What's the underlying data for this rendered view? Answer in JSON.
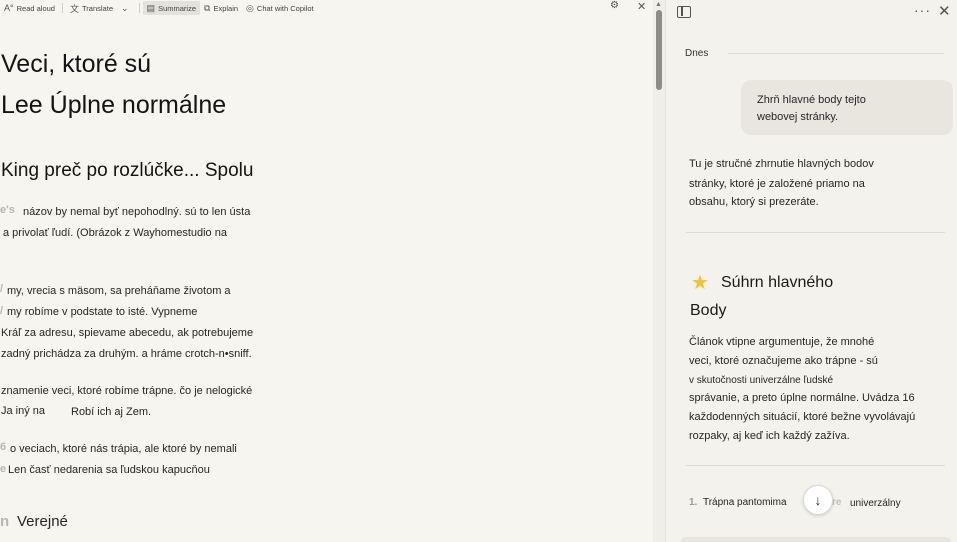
{
  "toolbar": {
    "read_aloud": "Read aloud",
    "translate": "Translate",
    "summarize": "Summarize",
    "explain": "Explain",
    "chat": "Chat with Copilot"
  },
  "article": {
    "title_line1": "Veci, ktoré sú",
    "title_line2": "Lee Úplne normálne",
    "subheading": "King preč po rozlúčke... Spolu",
    "ghost1": "e's",
    "p1_line1": "názov by nemal byť nepohodlný. sú to len ústa",
    "p1_line2": "a privolať ľudí. (Obrázok z Wayhomestudio na",
    "ghost2": "/",
    "p2_line1": "my, vrecia s mäsom, sa preháňame životom a",
    "ghost3": "/",
    "p2_line2": "my robíme v podstate to isté. Vypneme",
    "p2_line3": "Kráľ za adresu, spievame abecedu, ak potrebujeme",
    "p2_line4": "zadný prichádza za druhým. a hráme crotch-n•sniff.",
    "p3_line1": "znamenie veci, ktoré robíme trápne. čo je nelogické",
    "p3_line2a": "Ja iný na",
    "p3_line2b": "Robí ich aj Zem.",
    "ghost4": "6",
    "p4_line1": "o veciach, ktoré nás trápia, ale ktoré by nemali",
    "ghost5": "e",
    "p4_line2": "Len časť nedarenia sa ľudskou kapucňou",
    "ghost6": "n",
    "section": "Verejné"
  },
  "copilot": {
    "date_label": "Dnes",
    "user_msg_line1": "Zhrň hlavné body tejto",
    "user_msg_line2": "webovej stránky.",
    "reply_line1": "Tu je stručné zhrnutie hlavných bodov",
    "reply_line2": "stránky, ktoré je založené priamo na",
    "reply_line3": "obsahu, ktorý si prezeráte.",
    "summary_title": "Súhrn hlavného",
    "summary_title2": "Body",
    "sum_line1": "Článok vtipne argumentuje, že mnohé",
    "sum_line2": "veci, ktoré označujeme ako trápne - sú",
    "sum_line3": "v skutočnosti univerzálne ľudské",
    "sum_line4": "správanie, a preto úplne normálne. Uvádza 16",
    "sum_line5": "každodenných situácií, ktoré bežne vyvolávajú",
    "sum_line6": "rozpaky, aj keď ich každý zažíva.",
    "item_num": "1.",
    "item_text": "Trápna pantomima",
    "item_ghost": "re",
    "item_tail": "univerzálny"
  },
  "icons": {
    "read_aloud": "read-aloud-icon",
    "translate": "translate-icon",
    "summarize": "summarize-icon",
    "explain": "explain-icon",
    "chat": "copilot-icon",
    "settings": "gear-icon",
    "close": "close-icon",
    "sidebar": "sidebar-icon",
    "more": "more-icon",
    "star": "star-icon",
    "scroll_down": "arrow-down-icon"
  },
  "colors": {
    "page_bg": "#f7f5ef",
    "pane_bg": "#f4f2ed",
    "bubble_bg": "#e9e6df",
    "star": "#f1c232"
  }
}
